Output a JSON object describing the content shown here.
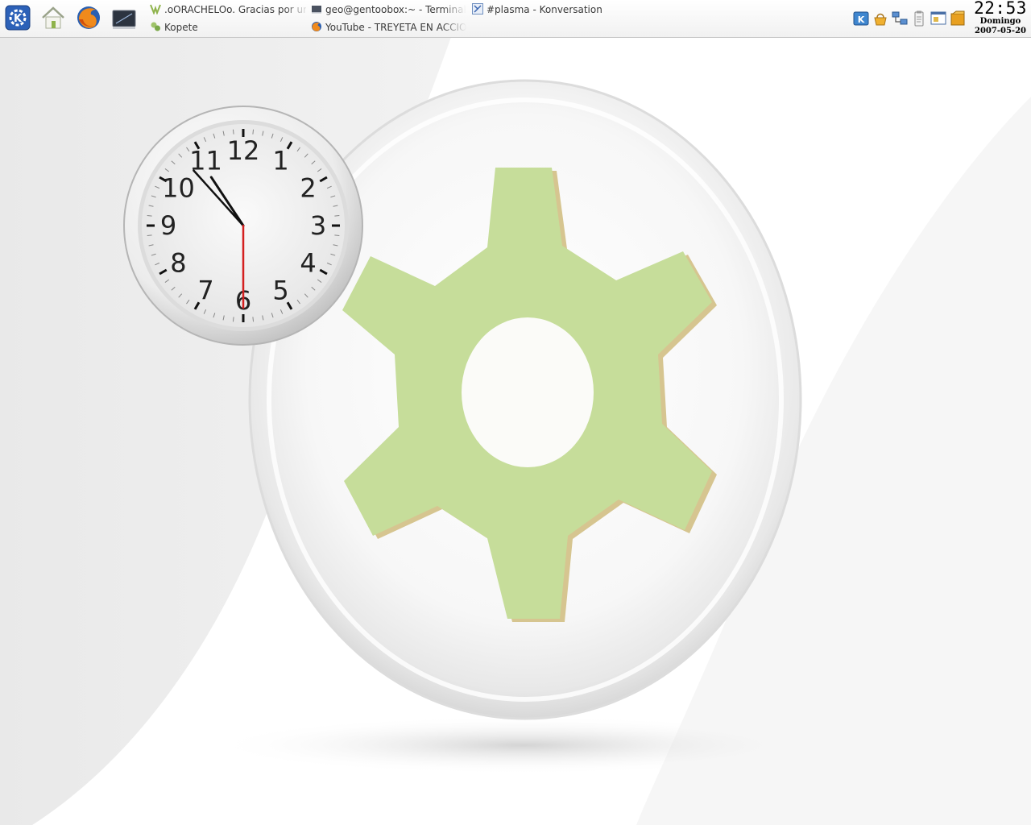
{
  "panel": {
    "launchers": [
      {
        "name": "kde-menu",
        "icon": "kde-gear-icon"
      },
      {
        "name": "home",
        "icon": "home-icon"
      },
      {
        "name": "firefox",
        "icon": "firefox-icon"
      },
      {
        "name": "terminal",
        "icon": "terminal-icon"
      }
    ],
    "tasks": [
      {
        "label": ".oORACHELOo.  Gracias por un",
        "icon": "kopete-chat-icon"
      },
      {
        "label": "geo@gentoobox:~ - Terminal",
        "icon": "terminal-icon"
      },
      {
        "label": "#plasma - Konversation",
        "icon": "konversation-icon"
      },
      {
        "label": "Kopete",
        "icon": "kopete-icon"
      },
      {
        "label": "YouTube - TREYETA EN ACCIO",
        "icon": "firefox-icon"
      }
    ],
    "tray": [
      {
        "icon": "kopete-tray-icon"
      },
      {
        "icon": "basket-icon"
      },
      {
        "icon": "network-icon"
      },
      {
        "icon": "klipper-icon"
      },
      {
        "icon": "window-list-icon"
      },
      {
        "icon": "notes-icon"
      }
    ],
    "clock": {
      "time": "22:53",
      "day": "Domingo",
      "date": "2007-05-20"
    }
  },
  "desktop": {
    "clock_widget": {
      "numerals": [
        "12",
        "1",
        "2",
        "3",
        "4",
        "5",
        "6",
        "7",
        "8",
        "9",
        "10",
        "11"
      ],
      "hour_hand_time": "10:53",
      "second_hand_seconds": 30
    },
    "colors": {
      "gear": "#c6dd9a",
      "gear_edge": "#d6c590",
      "second_hand": "#d42020"
    }
  }
}
